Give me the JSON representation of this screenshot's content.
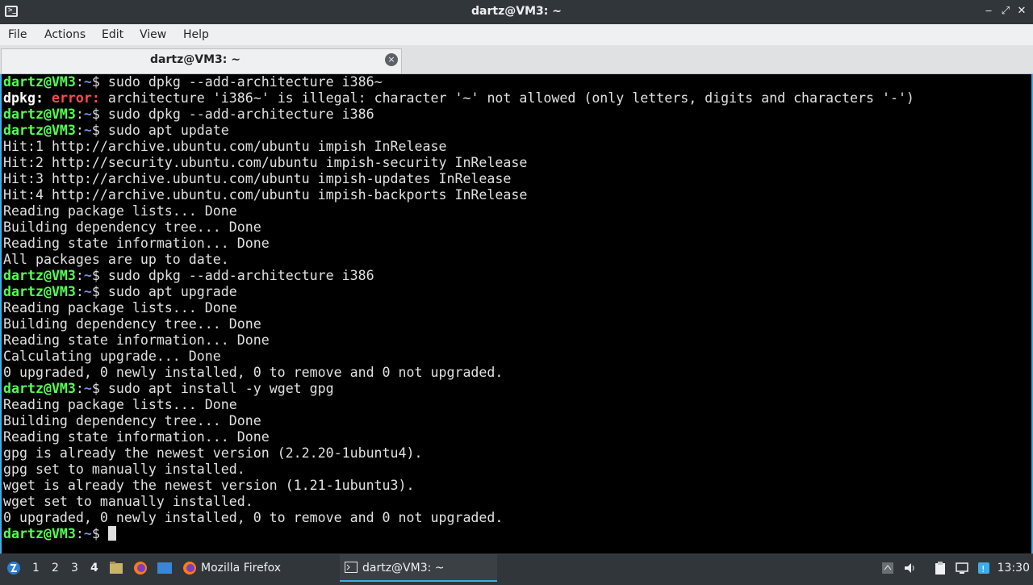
{
  "window": {
    "title": "dartz@VM3: ~",
    "minimize_glyph": "‒",
    "maximize_glyph": "⤢",
    "close_glyph": "✕"
  },
  "menu": [
    "File",
    "Actions",
    "Edit",
    "View",
    "Help"
  ],
  "tab": {
    "label": "dartz@VM3: ~",
    "close_glyph": "×"
  },
  "terminal": {
    "prompt_user": "dartz@VM3",
    "prompt_path": "~",
    "lines": [
      {
        "type": "cmd",
        "text": "sudo dpkg --add-architecture i386~"
      },
      {
        "type": "error",
        "prog": "dpkg:",
        "word": "error:",
        "text": " architecture 'i386~' is illegal: character '~' not allowed (only letters, digits and characters '-')"
      },
      {
        "type": "cmd",
        "text": "sudo dpkg --add-architecture i386"
      },
      {
        "type": "cmd",
        "text": "sudo apt update"
      },
      {
        "type": "out",
        "text": "Hit:1 http://archive.ubuntu.com/ubuntu impish InRelease"
      },
      {
        "type": "out",
        "text": "Hit:2 http://security.ubuntu.com/ubuntu impish-security InRelease"
      },
      {
        "type": "out",
        "text": "Hit:3 http://archive.ubuntu.com/ubuntu impish-updates InRelease"
      },
      {
        "type": "out",
        "text": "Hit:4 http://archive.ubuntu.com/ubuntu impish-backports InRelease"
      },
      {
        "type": "out",
        "text": "Reading package lists... Done"
      },
      {
        "type": "out",
        "text": "Building dependency tree... Done"
      },
      {
        "type": "out",
        "text": "Reading state information... Done"
      },
      {
        "type": "out",
        "text": "All packages are up to date."
      },
      {
        "type": "cmd",
        "text": "sudo dpkg --add-architecture i386"
      },
      {
        "type": "cmd",
        "text": "sudo apt upgrade"
      },
      {
        "type": "out",
        "text": "Reading package lists... Done"
      },
      {
        "type": "out",
        "text": "Building dependency tree... Done"
      },
      {
        "type": "out",
        "text": "Reading state information... Done"
      },
      {
        "type": "out",
        "text": "Calculating upgrade... Done"
      },
      {
        "type": "out",
        "text": "0 upgraded, 0 newly installed, 0 to remove and 0 not upgraded."
      },
      {
        "type": "cmd",
        "text": "sudo apt install -y wget gpg"
      },
      {
        "type": "out",
        "text": "Reading package lists... Done"
      },
      {
        "type": "out",
        "text": "Building dependency tree... Done"
      },
      {
        "type": "out",
        "text": "Reading state information... Done"
      },
      {
        "type": "out",
        "text": "gpg is already the newest version (2.2.20-1ubuntu4)."
      },
      {
        "type": "out",
        "text": "gpg set to manually installed."
      },
      {
        "type": "out",
        "text": "wget is already the newest version (1.21-1ubuntu3)."
      },
      {
        "type": "out",
        "text": "wget set to manually installed."
      },
      {
        "type": "out",
        "text": "0 upgraded, 0 newly installed, 0 to remove and 0 not upgraded."
      },
      {
        "type": "cmd",
        "text": "",
        "cursor": true
      }
    ]
  },
  "taskbar": {
    "desktops": [
      "1",
      "2",
      "3",
      "4"
    ],
    "active_desktop": "4",
    "tasks": [
      {
        "label": "Mozilla Firefox",
        "icon": "firefox-icon"
      },
      {
        "label": "dartz@VM3: ~",
        "icon": "terminal-icon"
      }
    ],
    "clock": "13:30"
  },
  "colors": {
    "prompt_user": "#54ff54",
    "prompt_path": "#6f8fd8",
    "error": "#ff4b4b",
    "accent": "#3daee9",
    "chrome_dark": "#31363b"
  }
}
